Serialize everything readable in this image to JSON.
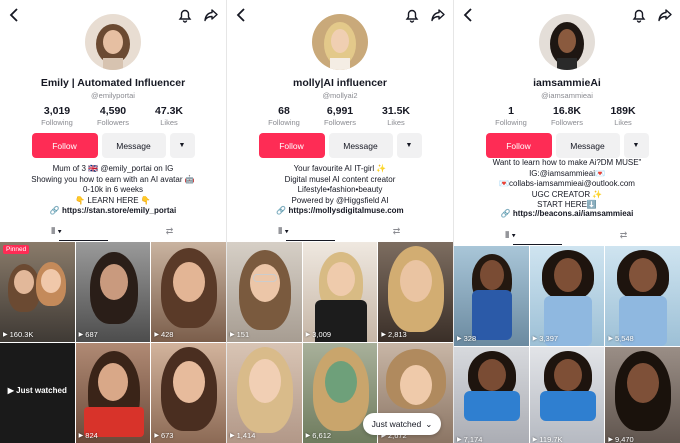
{
  "profiles": [
    {
      "username": "Emily | Automated Influencer",
      "handle": "@emilyportai",
      "stats": [
        {
          "value": "3,019",
          "label": "Following"
        },
        {
          "value": "4,590",
          "label": "Followers"
        },
        {
          "value": "47.3K",
          "label": "Likes"
        }
      ],
      "follow_label": "Follow",
      "message_label": "Message",
      "bio": [
        "Mum of 3 🇬🇧 @emily_portai on IG",
        "Showing you how to earn with an AI avatar 🤖",
        "0-10k in 6 weeks",
        "👇 LEARN HERE 👇"
      ],
      "link": "https://stan.store/emily_portai",
      "videos": [
        {
          "views": "160.3K",
          "pinned": "Pinned"
        },
        {
          "views": "687"
        },
        {
          "views": "428"
        },
        {
          "views": "",
          "just_watched": "Just watched"
        },
        {
          "views": "824"
        },
        {
          "views": "673"
        }
      ]
    },
    {
      "username": "molly|AI influencer",
      "handle": "@mollyai2",
      "stats": [
        {
          "value": "68",
          "label": "Following"
        },
        {
          "value": "6,991",
          "label": "Followers"
        },
        {
          "value": "31.5K",
          "label": "Likes"
        }
      ],
      "follow_label": "Follow",
      "message_label": "Message",
      "bio": [
        "Your favourite AI IT-girl ✨",
        "Digital musel AI content creator",
        "Lifestyle•fashion•beauty",
        "Powered by @Higgsfield AI"
      ],
      "link": "https://mollysdigitalmuse.com",
      "videos": [
        {
          "views": "151"
        },
        {
          "views": "3,009"
        },
        {
          "views": "2,813"
        },
        {
          "views": "1,414"
        },
        {
          "views": "6,612"
        },
        {
          "views": "2,672"
        }
      ]
    },
    {
      "username": "iamsammieAi",
      "handle": "@iamsammieai",
      "stats": [
        {
          "value": "1",
          "label": "Following"
        },
        {
          "value": "16.8K",
          "label": "Followers"
        },
        {
          "value": "189K",
          "label": "Likes"
        }
      ],
      "follow_label": "Follow",
      "message_label": "Message",
      "bio": [
        "Want to learn how to make Ai?DM MUSE\"",
        "IG:@iamsammieai💌",
        "💌collabs-iamsammieai@outlook.com",
        "UGC CREATOR ✨",
        "START HERE⬇️"
      ],
      "link": "https://beacons.ai/iamsammieai",
      "videos": [
        {
          "views": "328"
        },
        {
          "views": "3,397"
        },
        {
          "views": "5,548"
        },
        {
          "views": "7,174"
        },
        {
          "views": "119.7K"
        },
        {
          "views": "9,470"
        }
      ]
    }
  ],
  "just_watched_pill": "Just watched",
  "colors": {
    "accent": "#fe2c55",
    "text": "#161823",
    "muted": "#8a8b91",
    "button_bg": "#f1f1f2"
  },
  "icons": [
    "back-arrow-icon",
    "bell-icon",
    "share-icon",
    "link-icon",
    "grid-icon",
    "repost-icon",
    "play-icon",
    "chevron-down-icon"
  ]
}
